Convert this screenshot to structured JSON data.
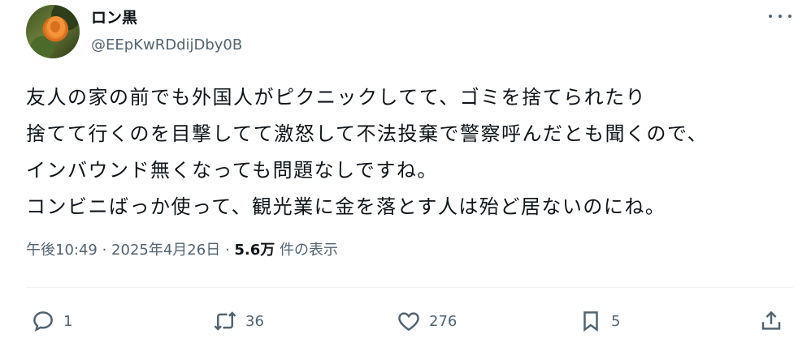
{
  "author": {
    "display_name": "ロン黒",
    "handle": "@EEpKwRDdijDby0B"
  },
  "post": {
    "lines": [
      "友人の家の前でも外国人がピクニックしてて、ゴミを捨てられたり",
      "捨てて行くのを目撃してて激怒して不法投棄で警察呼んだとも聞くので、",
      "インバウンド無くなっても問題なしですね。",
      "コンビニばっか使って、観光業に金を落とす人は殆ど居ないのにね。"
    ]
  },
  "meta": {
    "time": "午後10:49",
    "separator1": " · ",
    "date": "2025年4月26日",
    "separator2": " · ",
    "views_count": "5.6万",
    "views_label": " 件の表示"
  },
  "actions": {
    "reply_count": "1",
    "repost_count": "36",
    "like_count": "276",
    "bookmark_count": "5"
  },
  "icons": {
    "more": "more-horizontal-icon",
    "reply": "reply-icon",
    "repost": "repost-icon",
    "like": "heart-icon",
    "bookmark": "bookmark-icon",
    "share": "share-icon"
  },
  "colors": {
    "text": "#0f1419",
    "secondary": "#536471",
    "divider": "#eff3f4"
  }
}
